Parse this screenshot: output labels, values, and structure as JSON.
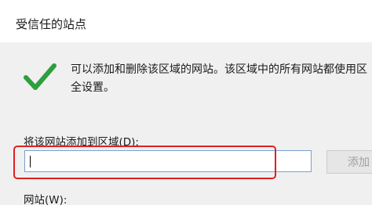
{
  "window": {
    "title": "受信任的站点"
  },
  "description": {
    "line1": "可以添加和删除该区域的网站。该区域中的所有网站都使用区",
    "line2": "全设置。"
  },
  "zone_field": {
    "label": "将该网站添加到区域(D):",
    "value": ""
  },
  "add_button": {
    "label": "添加"
  },
  "websites": {
    "label": "网站(W):"
  },
  "icons": {
    "status": "checkmark-icon"
  },
  "colors": {
    "highlight": "#e02020",
    "check": "#2e9e3e",
    "input_border": "#7a9fd0"
  }
}
